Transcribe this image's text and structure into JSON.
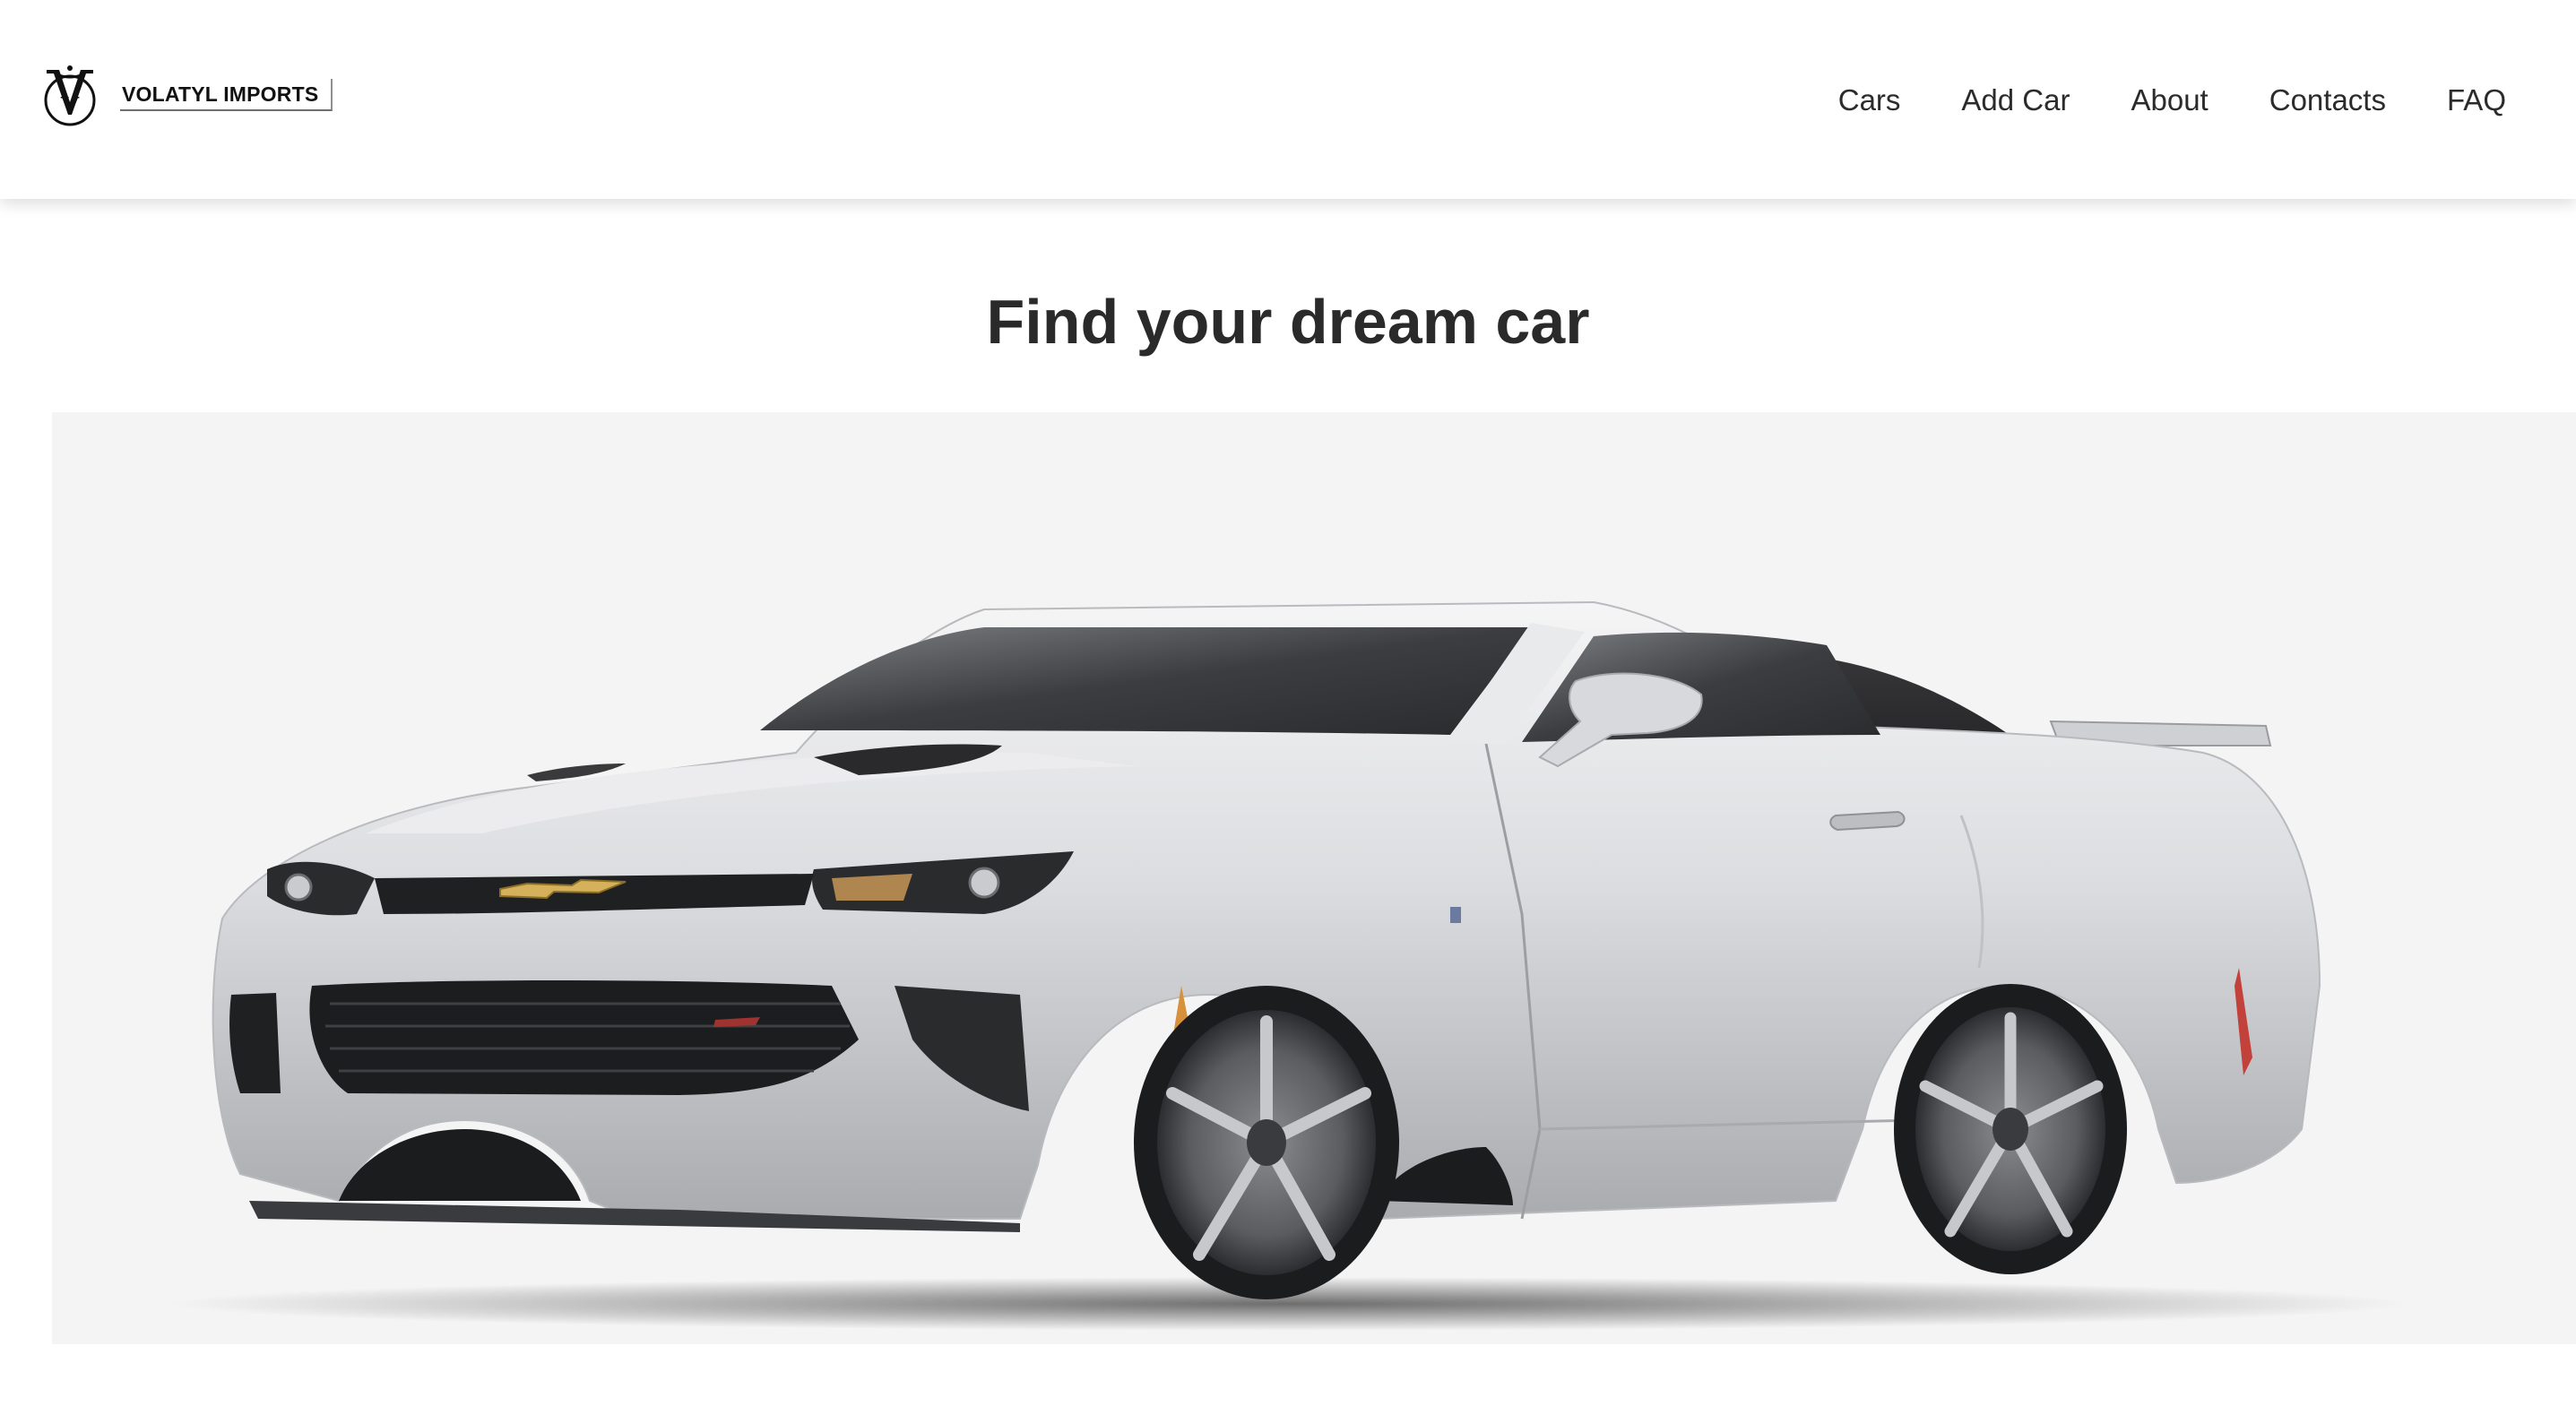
{
  "brand": {
    "name": "VOLATYL IMPORTS",
    "logo_icon": "v-crest-logo-icon",
    "logo_letter": "V"
  },
  "nav": {
    "items": [
      {
        "label": "Cars"
      },
      {
        "label": "Add Car"
      },
      {
        "label": "About"
      },
      {
        "label": "Contacts"
      },
      {
        "label": "FAQ"
      }
    ]
  },
  "main": {
    "title": "Find your dream car"
  },
  "hero": {
    "icon": "car-photo",
    "background": "#f4f4f4",
    "car_color": "#d9dadc",
    "roof_color": "#2f2f31"
  }
}
